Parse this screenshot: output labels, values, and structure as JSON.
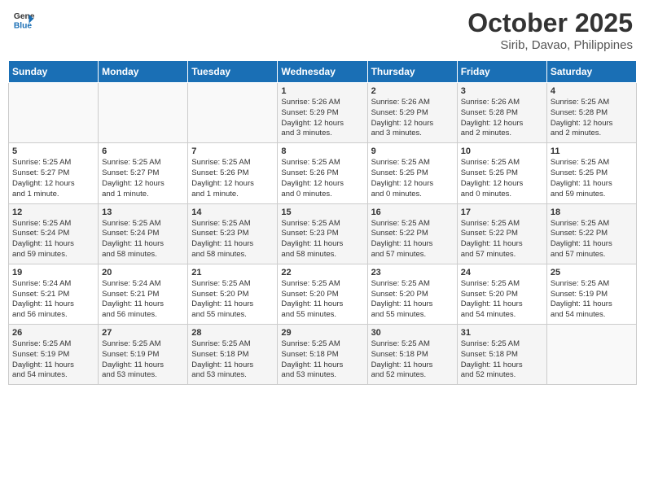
{
  "header": {
    "logo_line1": "General",
    "logo_line2": "Blue",
    "month": "October 2025",
    "location": "Sirib, Davao, Philippines"
  },
  "weekdays": [
    "Sunday",
    "Monday",
    "Tuesday",
    "Wednesday",
    "Thursday",
    "Friday",
    "Saturday"
  ],
  "weeks": [
    [
      {
        "day": "",
        "info": ""
      },
      {
        "day": "",
        "info": ""
      },
      {
        "day": "",
        "info": ""
      },
      {
        "day": "1",
        "info": "Sunrise: 5:26 AM\nSunset: 5:29 PM\nDaylight: 12 hours\nand 3 minutes."
      },
      {
        "day": "2",
        "info": "Sunrise: 5:26 AM\nSunset: 5:29 PM\nDaylight: 12 hours\nand 3 minutes."
      },
      {
        "day": "3",
        "info": "Sunrise: 5:26 AM\nSunset: 5:28 PM\nDaylight: 12 hours\nand 2 minutes."
      },
      {
        "day": "4",
        "info": "Sunrise: 5:25 AM\nSunset: 5:28 PM\nDaylight: 12 hours\nand 2 minutes."
      }
    ],
    [
      {
        "day": "5",
        "info": "Sunrise: 5:25 AM\nSunset: 5:27 PM\nDaylight: 12 hours\nand 1 minute."
      },
      {
        "day": "6",
        "info": "Sunrise: 5:25 AM\nSunset: 5:27 PM\nDaylight: 12 hours\nand 1 minute."
      },
      {
        "day": "7",
        "info": "Sunrise: 5:25 AM\nSunset: 5:26 PM\nDaylight: 12 hours\nand 1 minute."
      },
      {
        "day": "8",
        "info": "Sunrise: 5:25 AM\nSunset: 5:26 PM\nDaylight: 12 hours\nand 0 minutes."
      },
      {
        "day": "9",
        "info": "Sunrise: 5:25 AM\nSunset: 5:25 PM\nDaylight: 12 hours\nand 0 minutes."
      },
      {
        "day": "10",
        "info": "Sunrise: 5:25 AM\nSunset: 5:25 PM\nDaylight: 12 hours\nand 0 minutes."
      },
      {
        "day": "11",
        "info": "Sunrise: 5:25 AM\nSunset: 5:25 PM\nDaylight: 11 hours\nand 59 minutes."
      }
    ],
    [
      {
        "day": "12",
        "info": "Sunrise: 5:25 AM\nSunset: 5:24 PM\nDaylight: 11 hours\nand 59 minutes."
      },
      {
        "day": "13",
        "info": "Sunrise: 5:25 AM\nSunset: 5:24 PM\nDaylight: 11 hours\nand 58 minutes."
      },
      {
        "day": "14",
        "info": "Sunrise: 5:25 AM\nSunset: 5:23 PM\nDaylight: 11 hours\nand 58 minutes."
      },
      {
        "day": "15",
        "info": "Sunrise: 5:25 AM\nSunset: 5:23 PM\nDaylight: 11 hours\nand 58 minutes."
      },
      {
        "day": "16",
        "info": "Sunrise: 5:25 AM\nSunset: 5:22 PM\nDaylight: 11 hours\nand 57 minutes."
      },
      {
        "day": "17",
        "info": "Sunrise: 5:25 AM\nSunset: 5:22 PM\nDaylight: 11 hours\nand 57 minutes."
      },
      {
        "day": "18",
        "info": "Sunrise: 5:25 AM\nSunset: 5:22 PM\nDaylight: 11 hours\nand 57 minutes."
      }
    ],
    [
      {
        "day": "19",
        "info": "Sunrise: 5:24 AM\nSunset: 5:21 PM\nDaylight: 11 hours\nand 56 minutes."
      },
      {
        "day": "20",
        "info": "Sunrise: 5:24 AM\nSunset: 5:21 PM\nDaylight: 11 hours\nand 56 minutes."
      },
      {
        "day": "21",
        "info": "Sunrise: 5:25 AM\nSunset: 5:20 PM\nDaylight: 11 hours\nand 55 minutes."
      },
      {
        "day": "22",
        "info": "Sunrise: 5:25 AM\nSunset: 5:20 PM\nDaylight: 11 hours\nand 55 minutes."
      },
      {
        "day": "23",
        "info": "Sunrise: 5:25 AM\nSunset: 5:20 PM\nDaylight: 11 hours\nand 55 minutes."
      },
      {
        "day": "24",
        "info": "Sunrise: 5:25 AM\nSunset: 5:20 PM\nDaylight: 11 hours\nand 54 minutes."
      },
      {
        "day": "25",
        "info": "Sunrise: 5:25 AM\nSunset: 5:19 PM\nDaylight: 11 hours\nand 54 minutes."
      }
    ],
    [
      {
        "day": "26",
        "info": "Sunrise: 5:25 AM\nSunset: 5:19 PM\nDaylight: 11 hours\nand 54 minutes."
      },
      {
        "day": "27",
        "info": "Sunrise: 5:25 AM\nSunset: 5:19 PM\nDaylight: 11 hours\nand 53 minutes."
      },
      {
        "day": "28",
        "info": "Sunrise: 5:25 AM\nSunset: 5:18 PM\nDaylight: 11 hours\nand 53 minutes."
      },
      {
        "day": "29",
        "info": "Sunrise: 5:25 AM\nSunset: 5:18 PM\nDaylight: 11 hours\nand 53 minutes."
      },
      {
        "day": "30",
        "info": "Sunrise: 5:25 AM\nSunset: 5:18 PM\nDaylight: 11 hours\nand 52 minutes."
      },
      {
        "day": "31",
        "info": "Sunrise: 5:25 AM\nSunset: 5:18 PM\nDaylight: 11 hours\nand 52 minutes."
      },
      {
        "day": "",
        "info": ""
      }
    ]
  ]
}
